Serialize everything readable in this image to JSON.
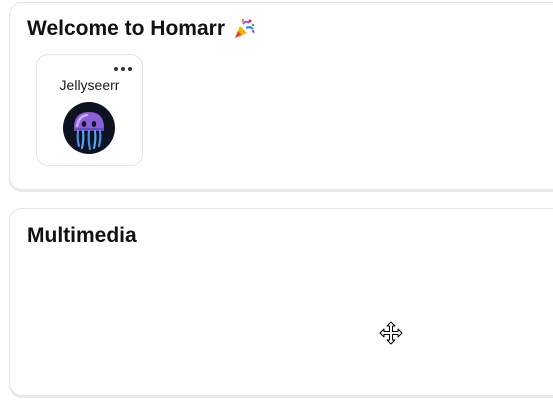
{
  "categories": [
    {
      "title": "Welcome to Homarr",
      "title_icon": "party-popper-icon",
      "apps": [
        {
          "name": "Jellyseerr",
          "icon": "jellyseerr-logo-icon"
        }
      ]
    },
    {
      "title": "Multimedia",
      "apps": []
    }
  ],
  "colors": {
    "border": "#e6e6e9",
    "logo_bg": "#0c1220",
    "jelly_purple": "#8b5fd6",
    "tentacle_blue": "#4c8fe0"
  },
  "cursor": "move-cursor-icon"
}
